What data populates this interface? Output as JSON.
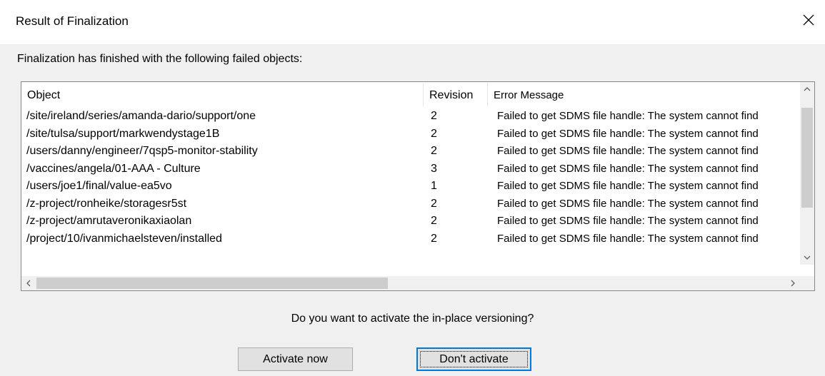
{
  "dialog": {
    "title": "Result of Finalization",
    "message": "Finalization has finished with the following failed objects:",
    "question": "Do you want to activate the in-place versioning?"
  },
  "table": {
    "columns": [
      "Object",
      "Revision",
      "Error Message"
    ],
    "rows": [
      {
        "object": "/site/ireland/series/amanda-dario/support/one",
        "revision": "2",
        "error": "Failed to get SDMS file handle: The system cannot find"
      },
      {
        "object": "/site/tulsa/support/markwendystage1B",
        "revision": "2",
        "error": "Failed to get SDMS file handle: The system cannot find"
      },
      {
        "object": "/users/danny/engineer/7qsp5-monitor-stability",
        "revision": "2",
        "error": "Failed to get SDMS file handle: The system cannot find"
      },
      {
        "object": "/vaccines/angela/01-AAA - Culture",
        "revision": "3",
        "error": "Failed to get SDMS file handle: The system cannot find"
      },
      {
        "object": "/users/joe1/final/value-ea5vo",
        "revision": "1",
        "error": "Failed to get SDMS file handle: The system cannot find"
      },
      {
        "object": "/z-project/ronheike/storagesr5st",
        "revision": "2",
        "error": "Failed to get SDMS file handle: The system cannot find"
      },
      {
        "object": "/z-project/amrutaveronikaxiaolan",
        "revision": "2",
        "error": "Failed to get SDMS file handle: The system cannot find"
      },
      {
        "object": "/project/10/ivanmichaelsteven/installed",
        "revision": "2",
        "error": "Failed to get SDMS file handle: The system cannot find"
      }
    ]
  },
  "buttons": {
    "activate": "Activate now",
    "dont_activate": "Don't activate"
  },
  "icons": {
    "close": "close-icon",
    "scroll_up": "chevron-up-icon",
    "scroll_down": "chevron-down-icon",
    "scroll_left": "chevron-left-icon",
    "scroll_right": "chevron-right-icon"
  },
  "colors": {
    "focus_border": "#0078d7",
    "dialog_bg": "#f0f0f0"
  }
}
